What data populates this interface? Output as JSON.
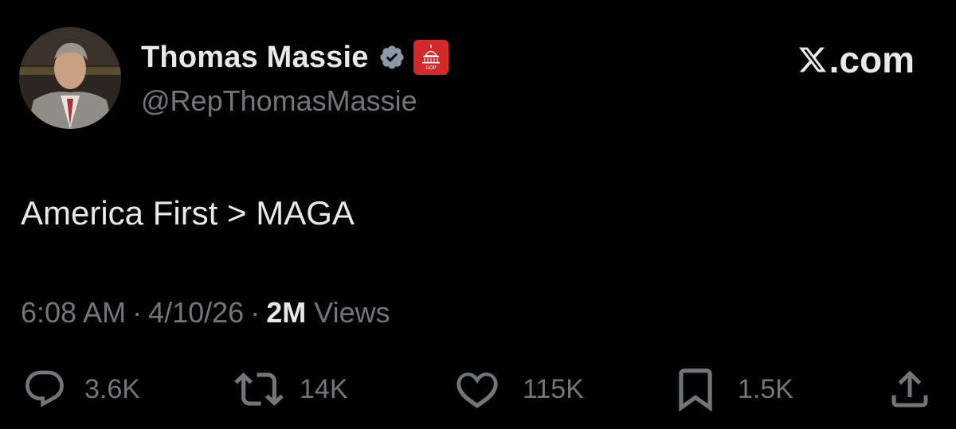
{
  "user": {
    "display_name": "Thomas Massie",
    "handle": "@RepThomasMassie",
    "verified_icon": "verified-badge-icon",
    "affiliation_icon": "house-gop-badge-icon",
    "affiliation_text": "GOP"
  },
  "brand": {
    "label": ".com",
    "icon": "x-logo-icon"
  },
  "tweet": {
    "text": "America First > MAGA",
    "time": "6:08 AM",
    "date": "4/10/26",
    "views_count": "2M",
    "views_label": "Views",
    "separator": "·"
  },
  "actions": {
    "reply": {
      "icon": "reply-icon",
      "count": "3.6K"
    },
    "repost": {
      "icon": "repost-icon",
      "count": "14K"
    },
    "like": {
      "icon": "like-icon",
      "count": "115K"
    },
    "bookmark": {
      "icon": "bookmark-icon",
      "count": "1.5K"
    },
    "share": {
      "icon": "share-icon"
    }
  },
  "colors": {
    "background": "#000000",
    "primary_text": "#e7e9ea",
    "secondary_text": "#71767b",
    "verified_fill": "#8b98a5",
    "affiliation_fill": "#d32a2a"
  }
}
